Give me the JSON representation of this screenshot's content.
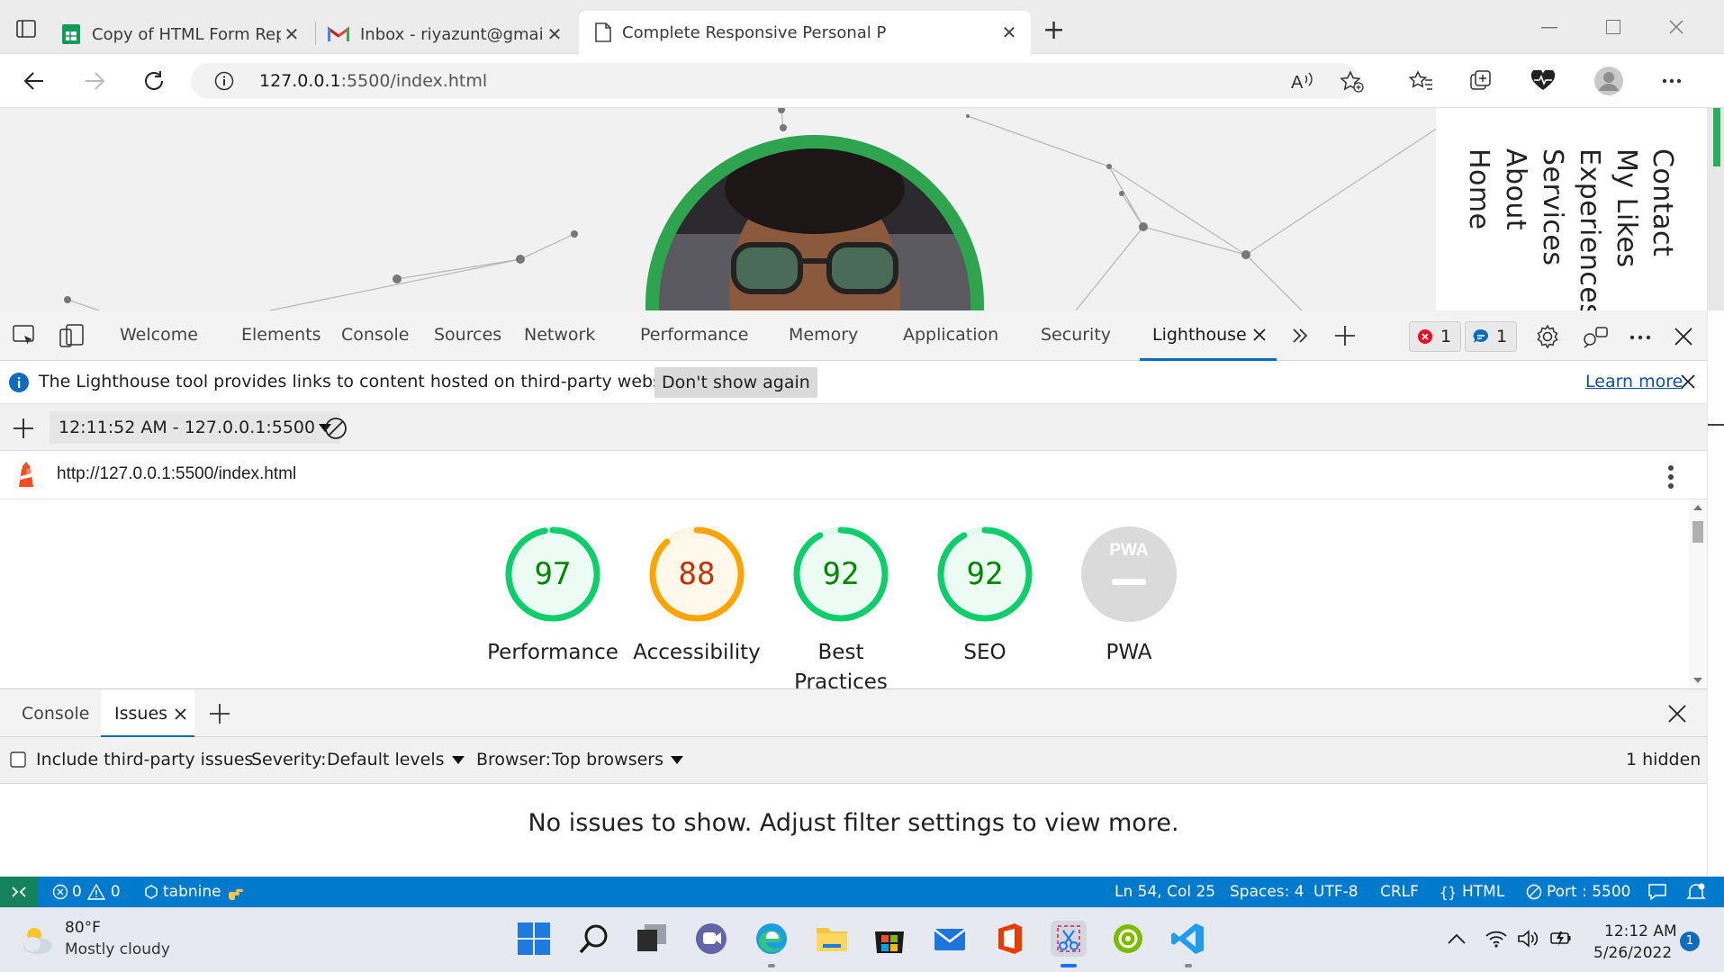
{
  "browser": {
    "tabs": [
      {
        "title": "Copy of HTML Form Reponses - ",
        "icon": "google-sheets-icon",
        "close": "✕"
      },
      {
        "title": "Inbox - riyazunt@gmail.com - Gr",
        "icon": "gmail-icon",
        "close": "✕"
      },
      {
        "title": "Complete Responsive Personal P",
        "icon": "page-icon",
        "close": "✕",
        "active": true
      }
    ],
    "new_tab": "+",
    "address": {
      "host": "127.0.0.1",
      "path": ":5500/index.html"
    }
  },
  "page": {
    "nav": [
      "Contact",
      "My Likes",
      "Experiences",
      "Services",
      "About",
      "Home"
    ]
  },
  "devtools": {
    "tabs": [
      "Welcome",
      "Elements",
      "Console",
      "Sources",
      "Network",
      "Performance",
      "Memory",
      "Application",
      "Security",
      "Lighthouse"
    ],
    "active_tab": "Lighthouse",
    "errors_count": "1",
    "messages_count": "1",
    "infobar": {
      "text": "The Lighthouse tool provides links to content hosted on third-party websites.",
      "dismiss": "Don't show again",
      "learn_more": "Learn more"
    },
    "report_select": "12:11:52 AM - 127.0.0.1:5500",
    "report_url": "http://127.0.0.1:5500/index.html",
    "scores": [
      {
        "label": "Performance",
        "score": "97",
        "value": 97,
        "color": "#0cce6b",
        "text_color": "#008800"
      },
      {
        "label": "Accessibility",
        "score": "88",
        "value": 88,
        "color": "#ffa400",
        "text_color": "#c33300"
      },
      {
        "label": "Best Practices",
        "score": "92",
        "value": 92,
        "color": "#0cce6b",
        "text_color": "#008800"
      },
      {
        "label": "SEO",
        "score": "92",
        "value": 92,
        "color": "#0cce6b",
        "text_color": "#008800"
      },
      {
        "label": "PWA",
        "score": "PWA",
        "value": null,
        "color": "#dadada",
        "text_color": "#ffffff"
      }
    ],
    "drawer": {
      "tabs": [
        "Console",
        "Issues"
      ],
      "active": "Issues",
      "include_third_party": "Include third-party issues",
      "severity_label": "Severity:",
      "severity_value": "Default levels",
      "browser_label": "Browser:",
      "browser_value": "Top browsers",
      "hidden": "1 hidden",
      "empty_message": "No issues to show. Adjust filter settings to view more."
    }
  },
  "statusbar": {
    "errors": "0",
    "warnings": "0",
    "tabnine": "tabnine",
    "position": "Ln 54, Col 25",
    "spaces": "Spaces: 4",
    "encoding": "UTF-8",
    "eol": "CRLF",
    "language": "HTML",
    "port": "Port : 5500"
  },
  "taskbar": {
    "weather_temp": "80°F",
    "weather_desc": "Mostly cloudy",
    "time": "12:12 AM",
    "date": "5/26/2022",
    "notifications": "1"
  },
  "colors": {
    "accent": "#0f6cbd",
    "vscode_status": "#007acc",
    "remote": "#16825d",
    "lh_pass": "#0cce6b",
    "lh_average": "#ffa400"
  }
}
